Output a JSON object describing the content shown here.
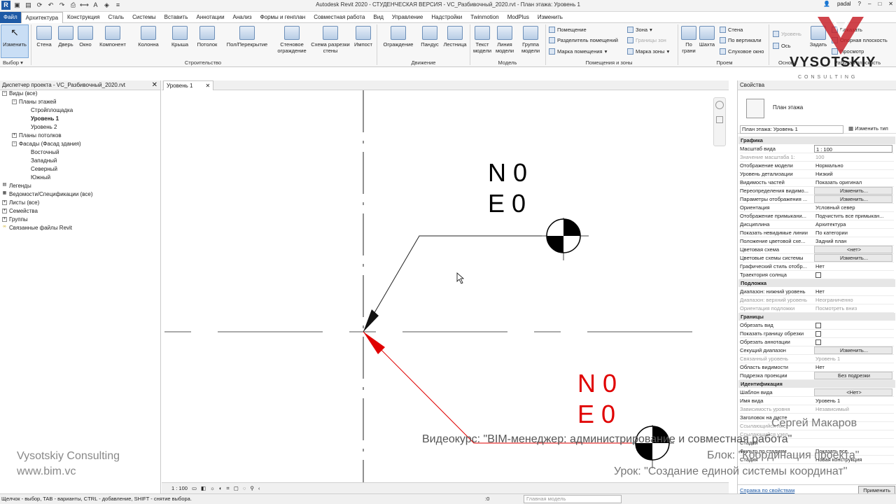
{
  "window": {
    "title": "Autodesk Revit 2020 - СТУДЕНЧЕСКАЯ ВЕРСИЯ - VC_Разбивочный_2020.rvt - План этажа: Уровень 1",
    "user": "padal"
  },
  "tabs": [
    "Файл",
    "Архитектура",
    "Конструкция",
    "Сталь",
    "Системы",
    "Вставить",
    "Аннотации",
    "Анализ",
    "Формы и генплан",
    "Совместная работа",
    "Вид",
    "Управление",
    "Надстройки",
    "Twinmotion",
    "ModPlus",
    "Изменить"
  ],
  "ribbon": {
    "modify": "Изменить",
    "select_panel": "Выбор",
    "build": [
      "Стена",
      "Дверь",
      "Окно",
      "Компонент",
      "Колонна",
      "Крыша",
      "Потолок",
      "Пол/Перекрытие",
      "Стеновое ограждение",
      "Схема разрезки стены",
      "Импост"
    ],
    "build_panel": "Строительство",
    "circulation": [
      "Ограждение",
      "Пандус",
      "Лестница"
    ],
    "circulation_panel": "Движение",
    "model": [
      "Текст модели",
      "Линия модели",
      "Группа модели"
    ],
    "model_panel": "Модель",
    "rooms": [
      "Помещение",
      "Разделитель помещений",
      "Марка помещения",
      "Зона",
      "Границы зон",
      "Марка зоны"
    ],
    "rooms_panel": "Помещения и зоны",
    "opening": [
      "По грани",
      "Шахта",
      "Стена",
      "По вертикали",
      "Слуховое окно"
    ],
    "opening_panel": "Проем",
    "datum": [
      "Уровень",
      "Ось"
    ],
    "datum_panel": "Основа",
    "workplane": [
      "Задать",
      "Показать",
      "Опорная плоскость",
      "Просмотр"
    ],
    "workplane_panel": "Рабочая плоскость"
  },
  "browser": {
    "title": "Диспетчер проекта - VC_Разбивочный_2020.rvt",
    "items": [
      {
        "label": "Виды (все)",
        "level": 0,
        "bold": false
      },
      {
        "label": "Планы этажей",
        "level": 1,
        "bold": false
      },
      {
        "label": "Стройплощадка",
        "level": 2,
        "bold": false
      },
      {
        "label": "Уровень 1",
        "level": 2,
        "bold": true
      },
      {
        "label": "Уровень 2",
        "level": 2,
        "bold": false
      },
      {
        "label": "Планы потолков",
        "level": 1,
        "bold": false
      },
      {
        "label": "Фасады (Фасад здания)",
        "level": 1,
        "bold": false
      },
      {
        "label": "Восточный",
        "level": 2,
        "bold": false
      },
      {
        "label": "Западный",
        "level": 2,
        "bold": false
      },
      {
        "label": "Северный",
        "level": 2,
        "bold": false
      },
      {
        "label": "Южный",
        "level": 2,
        "bold": false
      },
      {
        "label": "Легенды",
        "level": 0,
        "bold": false
      },
      {
        "label": "Ведомости/Спецификации (все)",
        "level": 0,
        "bold": false
      },
      {
        "label": "Листы (все)",
        "level": 0,
        "bold": false
      },
      {
        "label": "Семейства",
        "level": 0,
        "bold": false
      },
      {
        "label": "Группы",
        "level": 0,
        "bold": false
      },
      {
        "label": "Связанные файлы Revit",
        "level": 0,
        "bold": false
      }
    ]
  },
  "watermark": {
    "company": "Vysotskiy Consulting",
    "site": "www.bim.vc",
    "brand": "VYSOTSKIY",
    "brand_sub": "CONSULTING"
  },
  "view": {
    "tab": "Уровень 1",
    "survey_point": {
      "n": "N 0",
      "e": "E 0"
    },
    "base_point": {
      "n": "N 0",
      "e": "E 0"
    },
    "scale": "1 : 100"
  },
  "properties": {
    "title": "Свойства",
    "type_name": "План этажа",
    "instance": "План этажа: Уровень 1",
    "edit_type": "Изменить тип",
    "groups": [
      {
        "name": "Графика",
        "rows": [
          [
            "Масштаб вида",
            "1 : 100",
            "input"
          ],
          [
            "Значение масштаба    1:",
            "100",
            "grey"
          ],
          [
            "Отображение модели",
            "Нормально",
            ""
          ],
          [
            "Уровень детализации",
            "Низкий",
            ""
          ],
          [
            "Видимость частей",
            "Показать оригинал",
            ""
          ],
          [
            "Переопределения видимо...",
            "Изменить...",
            "btn"
          ],
          [
            "Параметры отображения ...",
            "Изменить...",
            "btn"
          ],
          [
            "Ориентация",
            "Условный север",
            ""
          ],
          [
            "Отображение примыкани...",
            "Подчистить все примыкан...",
            ""
          ],
          [
            "Дисциплина",
            "Архитектура",
            ""
          ],
          [
            "Показать невидимые линии",
            "По категории",
            ""
          ],
          [
            "Положение цветовой схе...",
            "Задний план",
            ""
          ],
          [
            "Цветовая схема",
            "<нет>",
            "btn"
          ],
          [
            "Цветовые схемы системы",
            "Изменить...",
            "btn"
          ],
          [
            "Графический стиль отобр...",
            "Нет",
            ""
          ],
          [
            "Траектория солнца",
            "",
            "cb"
          ]
        ]
      },
      {
        "name": "Подложка",
        "rows": [
          [
            "Диапазон: нижний уровень",
            "Нет",
            ""
          ],
          [
            "Диапазон: верхний уровень",
            "Неограниченно",
            "grey"
          ],
          [
            "Ориентация подложки",
            "Посмотреть вниз",
            "grey"
          ]
        ]
      },
      {
        "name": "Границы",
        "rows": [
          [
            "Обрезать вид",
            "",
            "cb"
          ],
          [
            "Показать границу обрезки",
            "",
            "cb"
          ],
          [
            "Обрезать аннотации",
            "",
            "cb"
          ],
          [
            "Секущий диапазон",
            "Изменить...",
            "btn"
          ],
          [
            "Связанный уровень",
            "Уровень 1",
            "grey"
          ],
          [
            "Область видимости",
            "Нет",
            ""
          ],
          [
            "Подрезка проекции",
            "Без подрезки",
            "btn"
          ]
        ]
      },
      {
        "name": "Идентификация",
        "rows": [
          [
            "Шаблон вида",
            "<Нет>",
            "btn"
          ],
          [
            "Имя вида",
            "Уровень 1",
            ""
          ],
          [
            "Зависимость уровня",
            "Независимый",
            "grey"
          ],
          [
            "Заголовок на листе",
            "",
            ""
          ],
          [
            "Ссылающийся лист",
            "",
            "grey"
          ],
          [
            "Ссылающийся узел",
            "",
            "grey"
          ],
          [
            "Стадии",
            "",
            ""
          ],
          [
            "Фильтр по стадиям",
            "Показать все",
            ""
          ],
          [
            "Стадия",
            "Новая конструкция",
            ""
          ]
        ]
      }
    ],
    "help": "Справка по свойствам",
    "apply": "Применить"
  },
  "overlay": {
    "author": "Сергей Макаров",
    "course": "Видеокурс: \"BIM-менеджер: администрирование и совместная работа\"",
    "block": "Блок: \"Координация проекта\"",
    "lesson": "Урок: \"Создание единой системы координат\""
  },
  "status": {
    "message": "Щелчок - выбор, TAB - варианты, CTRL - добавление, SHIFT - снятие выбора.",
    "zero": ":0",
    "model": "Главная модель"
  },
  "colors": {
    "accent": "#1e5aa6",
    "survey": "#000000",
    "base": "#e00000"
  }
}
